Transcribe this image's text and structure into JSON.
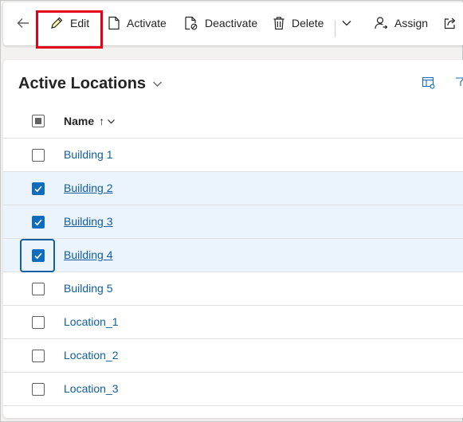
{
  "toolbar": {
    "edit_label": "Edit",
    "activate_label": "Activate",
    "deactivate_label": "Deactivate",
    "delete_label": "Delete",
    "assign_label": "Assign"
  },
  "view": {
    "title": "Active Locations"
  },
  "grid": {
    "column_name": "Name",
    "sort_indicator": "↑",
    "rows": [
      {
        "name": "Building 1",
        "selected": false
      },
      {
        "name": "Building 2",
        "selected": true
      },
      {
        "name": "Building 3",
        "selected": true
      },
      {
        "name": "Building 4",
        "selected": true
      },
      {
        "name": "Building 5",
        "selected": false
      },
      {
        "name": "Location_1",
        "selected": false
      },
      {
        "name": "Location_2",
        "selected": false
      },
      {
        "name": "Location_3",
        "selected": false
      }
    ]
  },
  "colors": {
    "link": "#115ea3",
    "selected_row": "#ebf3fc",
    "checkbox_checked": "#0f6cbd",
    "highlight_box": "#e3001b"
  }
}
